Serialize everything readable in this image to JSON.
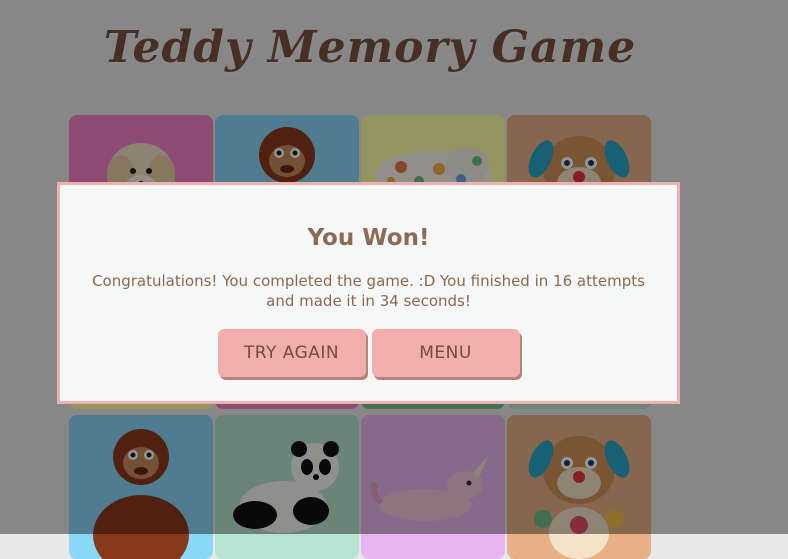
{
  "game": {
    "title": "Teddy Memory Game"
  },
  "board": {
    "cards": [
      {
        "toy": "puppy-plush",
        "color": "#f184c9",
        "revealed": true
      },
      {
        "toy": "orangutan-plush",
        "color": "#88d8f6",
        "revealed": true
      },
      {
        "toy": "dotted-plush",
        "color": "#ffffa8",
        "revealed": true
      },
      {
        "toy": "laugh-learn-puppy",
        "color": "#e8b087",
        "revealed": true
      },
      {
        "toy": "hidden",
        "color": "#ffffa8",
        "revealed": true
      },
      {
        "toy": "hidden",
        "color": "#f184c9",
        "revealed": true
      },
      {
        "toy": "hidden",
        "color": "#7fbf90",
        "revealed": true
      },
      {
        "toy": "hidden",
        "color": "#b7e3d2",
        "revealed": true
      },
      {
        "toy": "orangutan-plush",
        "color": "#88d8f6",
        "revealed": true
      },
      {
        "toy": "panda-plush",
        "color": "#b7e3d2",
        "revealed": true
      },
      {
        "toy": "unicorn-plush",
        "color": "#e8b5f0",
        "revealed": true
      },
      {
        "toy": "laugh-learn-puppy",
        "color": "#e8b087",
        "revealed": true
      }
    ]
  },
  "modal": {
    "title": "You Won!",
    "message": "Congratulations! You completed the game. :D You finished in 16 attempts and made it in 34 seconds!",
    "attempts": 16,
    "seconds": 34,
    "try_again_label": "TRY AGAIN",
    "menu_label": "MENU"
  },
  "colors": {
    "accent": "#f2aeac",
    "title_brown": "#7a5240",
    "modal_border": "#efb1b0"
  }
}
